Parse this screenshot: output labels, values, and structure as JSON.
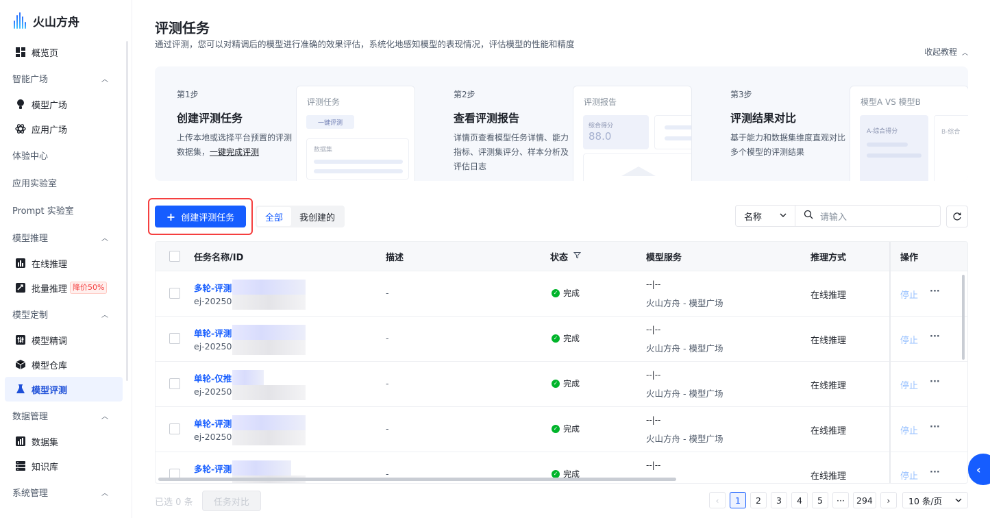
{
  "brand": {
    "name": "火山方舟",
    "accent": "#165dff"
  },
  "sidebar": {
    "top": {
      "label": "概览页",
      "icon": "dashboard-icon"
    },
    "groups": [
      {
        "label": "智能广场",
        "expanded": true,
        "items": [
          {
            "label": "模型广场",
            "icon": "bulb-icon"
          },
          {
            "label": "应用广场",
            "icon": "atom-icon"
          }
        ]
      },
      {
        "label": "体验中心",
        "expanded": false,
        "items": []
      },
      {
        "label": "应用实验室",
        "expanded": false,
        "items": []
      },
      {
        "label": "Prompt 实验室",
        "expanded": false,
        "items": []
      },
      {
        "label": "模型推理",
        "expanded": true,
        "items": [
          {
            "label": "在线推理",
            "icon": "chart-icon"
          },
          {
            "label": "批量推理",
            "icon": "batch-icon",
            "badge": "降价50%"
          }
        ]
      },
      {
        "label": "模型定制",
        "expanded": true,
        "items": [
          {
            "label": "模型精调",
            "icon": "tune-icon"
          },
          {
            "label": "模型仓库",
            "icon": "cube-icon"
          },
          {
            "label": "模型评测",
            "icon": "flask-icon",
            "active": true
          }
        ]
      },
      {
        "label": "数据管理",
        "expanded": true,
        "items": [
          {
            "label": "数据集",
            "icon": "dataset-icon"
          },
          {
            "label": "知识库",
            "icon": "database-icon"
          }
        ]
      },
      {
        "label": "系统管理",
        "expanded": true,
        "items": []
      }
    ]
  },
  "page": {
    "title": "评测任务",
    "subtitle": "通过评测，您可以对精调后的模型进行准确的效果评估，系统化地感知模型的表现情况，评估模型的性能和精度",
    "collapse_label": "收起教程"
  },
  "guide": {
    "steps": [
      {
        "no": "第1步",
        "title": "创建评测任务",
        "desc": "上传本地或选择平台预置的评测数据集，",
        "link": "一键完成评测",
        "card_title": "评测任务",
        "card_btn": "一键评测",
        "card_field": "数据集"
      },
      {
        "no": "第2步",
        "title": "查看评测报告",
        "desc": "详情页查看模型任务详情、能力指标、评测集评分、样本分析及评估日志",
        "card_title": "评测报告",
        "card_metric_label": "综合得分",
        "card_metric_value": "88.0"
      },
      {
        "no": "第3步",
        "title": "评测结果对比",
        "desc": "基于能力和数据集维度直观对比多个模型的评测结果",
        "card_title": "模型A VS 模型B",
        "card_a": "A-综合得分",
        "card_b": "B-综合"
      }
    ]
  },
  "toolbar": {
    "create_label": "创建评测任务",
    "tabs": [
      {
        "label": "全部",
        "active": true
      },
      {
        "label": "我创建的",
        "active": false
      }
    ],
    "filter_field": "名称",
    "search_placeholder": "请输入"
  },
  "table": {
    "columns": [
      "任务名称/ID",
      "描述",
      "状态",
      "模型服务",
      "推理方式",
      "操作"
    ],
    "rows": [
      {
        "name": "多轮-评测",
        "id": "ej-202505",
        "desc": "-",
        "status": "完成",
        "service_top": "--|--",
        "service": "火山方舟 - 模型广场",
        "mode": "在线推理",
        "action": "停止",
        "more": "···"
      },
      {
        "name": "单轮-评测",
        "id": "ej-202505",
        "desc": "-",
        "status": "完成",
        "service_top": "--|--",
        "service": "火山方舟 - 模型广场",
        "mode": "在线推理",
        "action": "停止",
        "more": "···"
      },
      {
        "name": "单轮-仅推",
        "id": "ej-202505",
        "desc": "-",
        "status": "完成",
        "service_top": "--|--",
        "service": "火山方舟 - 模型广场",
        "mode": "在线推理",
        "action": "停止",
        "more": "···"
      },
      {
        "name": "单轮-评测",
        "id": "ej-202505",
        "desc": "-",
        "status": "完成",
        "service_top": "--|--",
        "service": "火山方舟 - 模型广场",
        "mode": "在线推理",
        "action": "停止",
        "more": "···"
      },
      {
        "name": "多轮-评测",
        "id": "",
        "desc": "-",
        "status": "完成",
        "service_top": "--|--",
        "service": "",
        "mode": "在线推理",
        "action": "停止",
        "more": "···"
      }
    ]
  },
  "footer": {
    "selected_prefix": "已选",
    "selected_count": "0",
    "selected_suffix": "条",
    "compare_label": "任务对比",
    "pages": [
      "1",
      "2",
      "3",
      "4",
      "5",
      "···",
      "294"
    ],
    "current_page": "1",
    "page_size": "10 条/页"
  }
}
